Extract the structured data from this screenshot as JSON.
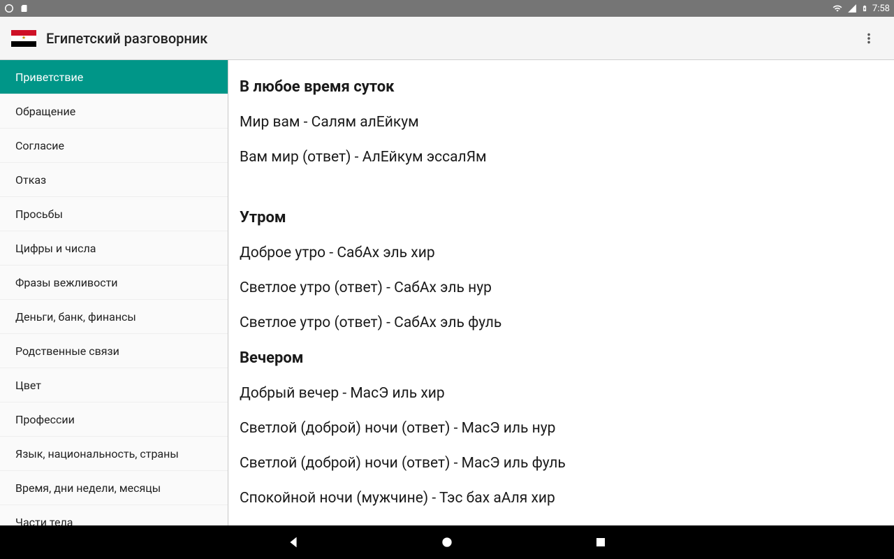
{
  "status": {
    "time": "7:58"
  },
  "appbar": {
    "title": "Египетский разговорник"
  },
  "sidebar": {
    "items": [
      {
        "label": "Приветствие",
        "active": true
      },
      {
        "label": "Обращение"
      },
      {
        "label": "Согласие"
      },
      {
        "label": "Отказ"
      },
      {
        "label": "Просьбы"
      },
      {
        "label": "Цифры и числа"
      },
      {
        "label": "Фразы вежливости"
      },
      {
        "label": "Деньги, банк, финансы"
      },
      {
        "label": "Родственные связи"
      },
      {
        "label": "Цвет"
      },
      {
        "label": "Профессии"
      },
      {
        "label": "Язык, национальность, страны"
      },
      {
        "label": "Время, дни недели, месяцы"
      },
      {
        "label": "Части тела"
      }
    ]
  },
  "content": {
    "sections": [
      {
        "title": "В любое время суток",
        "phrases": [
          "Мир вам - Салям алЕйкум",
          "Вам мир (ответ) - АлЕйкум эссалЯм"
        ],
        "gapAfter": true
      },
      {
        "title": "Утром",
        "phrases": [
          "Доброе утро - СабАх эль хир",
          "Светлое утро (ответ) - СабАх эль нур",
          "Светлое утро (ответ) - СабАх эль фуль"
        ]
      },
      {
        "title": "Вечером",
        "phrases": [
          "Добрый вечер - МасЭ иль хир",
          "Светлой (доброй) ночи (ответ) - МасЭ иль нур",
          "Светлой (доброй) ночи (ответ) - МасЭ иль фуль",
          "Спокойной ночи (мужчине) - Тэс бах аАля хир"
        ]
      }
    ]
  }
}
